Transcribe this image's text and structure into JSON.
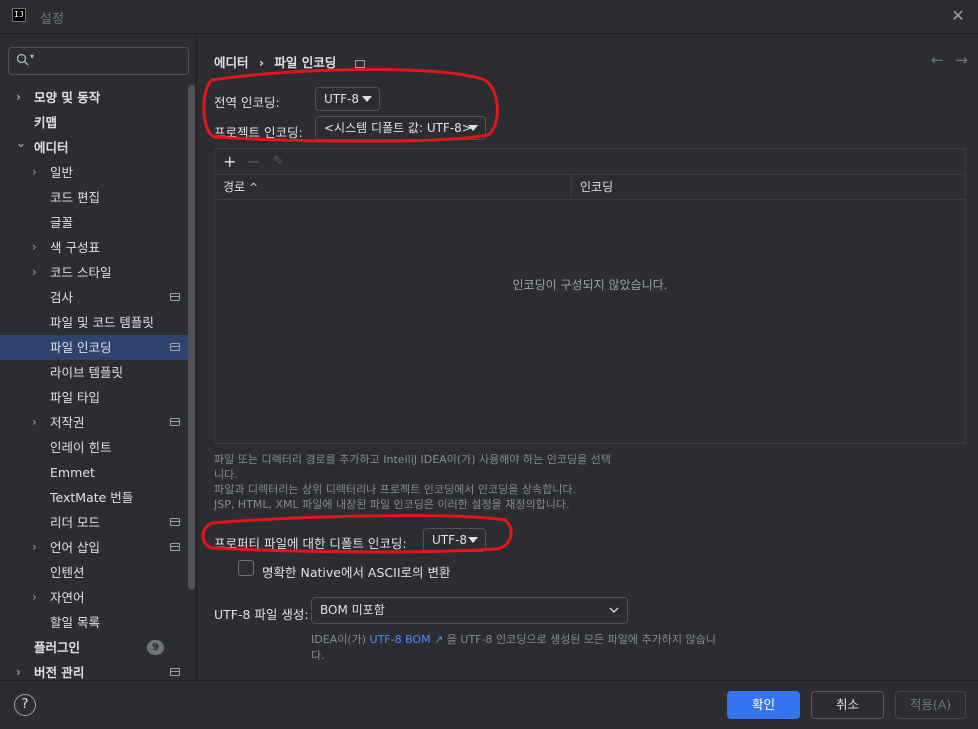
{
  "window": {
    "title": "설정",
    "logo_text": "IJ"
  },
  "sidebar": {
    "search_placeholder": "",
    "items": [
      {
        "label": "모양 및 동작",
        "level": 0,
        "expandable": true,
        "bold": true
      },
      {
        "label": "키맵",
        "level": 0,
        "expandable": false,
        "bold": true
      },
      {
        "label": "에디터",
        "level": 0,
        "expandable": true,
        "expanded": true,
        "bold": true
      },
      {
        "label": "일반",
        "level": 1,
        "expandable": true
      },
      {
        "label": "코드 편집",
        "level": 1
      },
      {
        "label": "글꼴",
        "level": 1
      },
      {
        "label": "색 구성표",
        "level": 1,
        "expandable": true
      },
      {
        "label": "코드 스타일",
        "level": 1,
        "expandable": true
      },
      {
        "label": "검사",
        "level": 1,
        "project": true
      },
      {
        "label": "파일 및 코드 템플릿",
        "level": 1
      },
      {
        "label": "파일 인코딩",
        "level": 1,
        "project": true,
        "selected": true
      },
      {
        "label": "라이브 템플릿",
        "level": 1
      },
      {
        "label": "파일 타입",
        "level": 1
      },
      {
        "label": "저작권",
        "level": 1,
        "expandable": true,
        "project": true
      },
      {
        "label": "인레이 힌트",
        "level": 1
      },
      {
        "label": "Emmet",
        "level": 1
      },
      {
        "label": "TextMate 번들",
        "level": 1
      },
      {
        "label": "리더 모드",
        "level": 1,
        "project": true
      },
      {
        "label": "언어 삽입",
        "level": 1,
        "expandable": true,
        "project": true
      },
      {
        "label": "인텐션",
        "level": 1
      },
      {
        "label": "자연어",
        "level": 1,
        "expandable": true
      },
      {
        "label": "할일 목록",
        "level": 1
      },
      {
        "label": "플러그인",
        "level": 0,
        "bold": true,
        "badge": "9"
      },
      {
        "label": "버전 관리",
        "level": 0,
        "expandable": true,
        "bold": true,
        "project": true
      }
    ]
  },
  "breadcrumb": {
    "parent": "에디터",
    "separator": "›",
    "current": "파일 인코딩"
  },
  "settings": {
    "global_label": "전역 인코딩:",
    "global_value": "UTF-8",
    "project_label": "프로젝트 인코딩:",
    "project_value": "<시스템 디폴트 값: UTF-8>",
    "table": {
      "col_path": "경로",
      "sort_indicator": "^",
      "col_encoding": "인코딩",
      "empty_text": "인코딩이 구성되지 않았습니다.",
      "add_btn": "+",
      "remove_btn": "−",
      "edit_btn": "✎"
    },
    "hint_lines": [
      "파일 또는 디렉터리 경로를 추가하고 IntelliJ IDEA이(가) 사용해야 하는 인코딩을 선택",
      "니다.",
      "파일과 디렉터리는 상위 디렉터리나 프로젝트 인코딩에서 인코딩을 상속합니다.",
      "JSP, HTML, XML 파일에 내장된 파일 인코딩은 이러한 설정을 재정의합니다."
    ],
    "properties_label": "프로퍼티 파일에 대한 디폴트 인코딩:",
    "properties_value": "UTF-8",
    "native_checkbox_label": "명확한 Native에서 ASCII로의 변환",
    "native_checked": false,
    "bom_label": "UTF-8 파일 생성:",
    "bom_value": "BOM 미포함",
    "bom_hint_prefix": "IDEA이(가) ",
    "bom_hint_link": "UTF-8 BOM ↗",
    "bom_hint_suffix": " 을 UTF-8 인코딩으로 생성된 모든 파일에 추가하지 않습니",
    "bom_hint_line2": "다."
  },
  "footer": {
    "help": "?",
    "ok": "확인",
    "cancel": "취소",
    "apply": "적용(A)"
  },
  "colors": {
    "accent": "#3574f0",
    "selection": "#2e436e",
    "annotation": "#e0161b",
    "link": "#548af7"
  }
}
